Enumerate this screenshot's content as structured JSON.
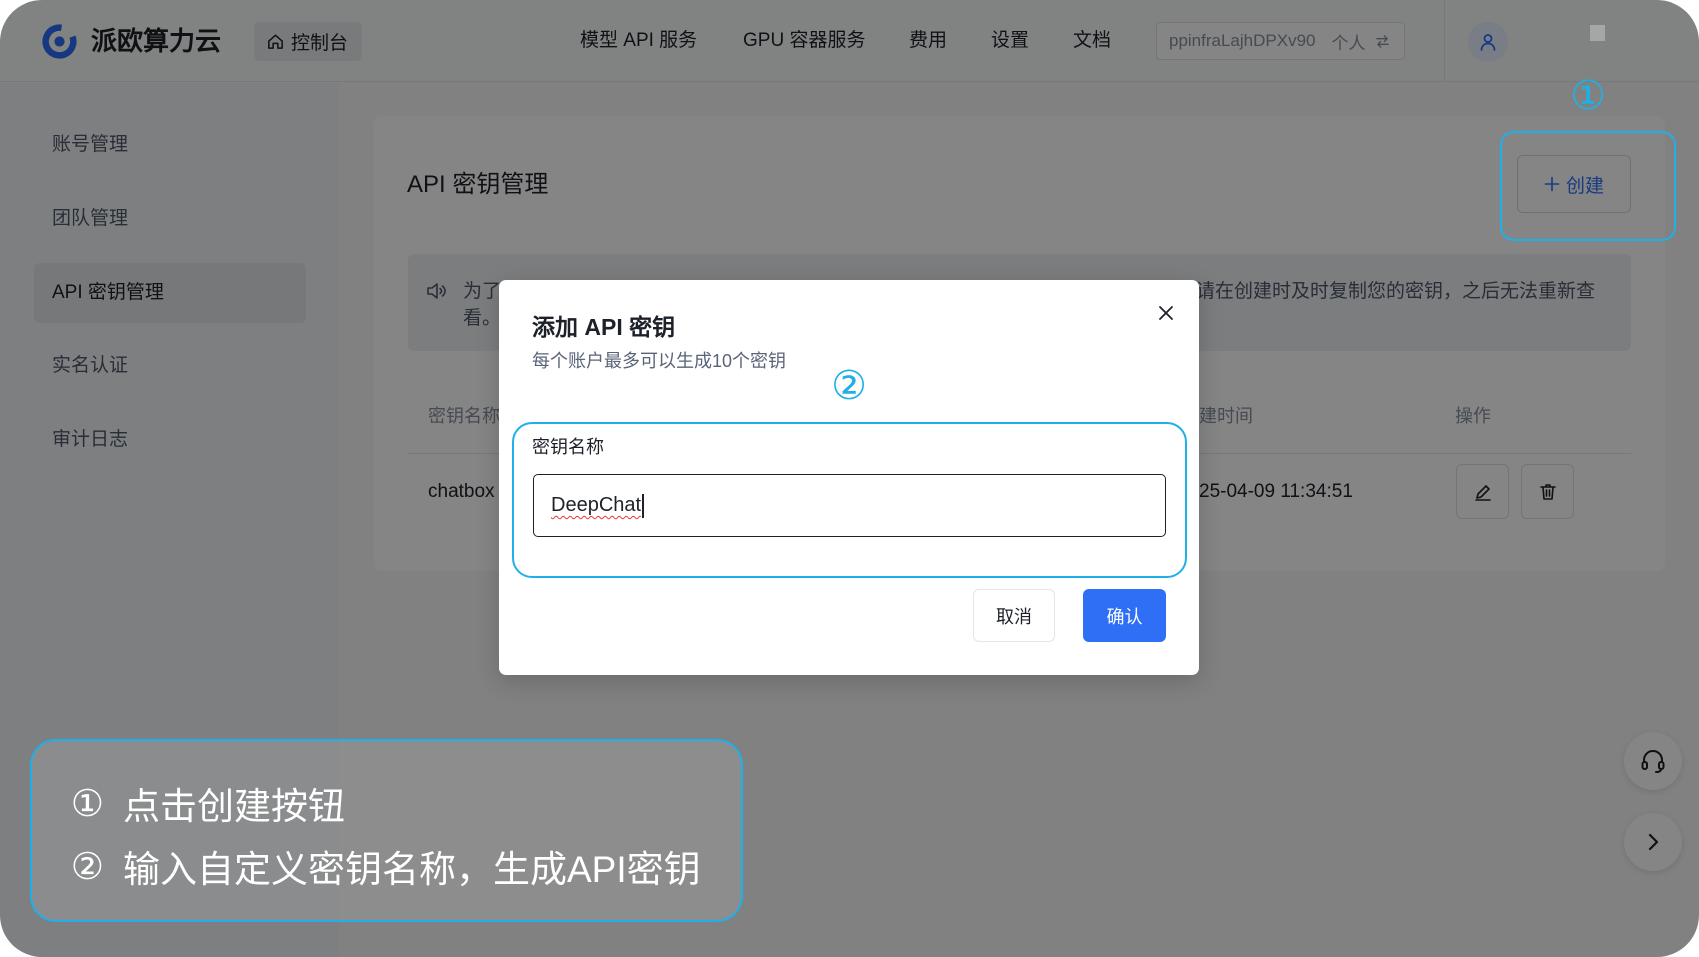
{
  "header": {
    "brand": "派欧算力云",
    "console_label": "控制台",
    "console_icon": "home-icon",
    "nav": [
      {
        "label": "模型 API 服务"
      },
      {
        "label": "GPU 容器服务"
      },
      {
        "label": "费用"
      },
      {
        "label": "设置"
      },
      {
        "label": "文档"
      }
    ],
    "account": {
      "name": "ppinfraLajhDPXv90",
      "type": "个人",
      "icon": "swap-icon"
    },
    "avatar_icon": "user-icon"
  },
  "sidebar": {
    "items": [
      {
        "label": "账号管理"
      },
      {
        "label": "团队管理"
      },
      {
        "label": "API 密钥管理",
        "active": true
      },
      {
        "label": "实名认证"
      },
      {
        "label": "审计日志"
      }
    ]
  },
  "main": {
    "title": "API 密钥管理",
    "create_label": "创建",
    "create_icon": "plus-icon",
    "notice": {
      "icon": "speaker-icon",
      "line1_left": "为了",
      "line1_right": "请在创建时及时复制您的密钥，之后无法重新查",
      "line2": "看。"
    },
    "table": {
      "columns": [
        "密钥名称",
        "建时间",
        "操作"
      ],
      "rows": [
        {
          "name": "chatbox",
          "created": "25-04-09 11:34:51"
        }
      ]
    }
  },
  "modal": {
    "title": "添加 API 密钥",
    "subtitle": "每个账户最多可以生成10个密钥",
    "field_label": "密钥名称",
    "field_value": "DeepChat",
    "cancel_label": "取消",
    "confirm_label": "确认"
  },
  "annotations": {
    "marker_1": "①",
    "marker_2": "②",
    "steps": [
      {
        "marker": "①",
        "text": "点击创建按钮"
      },
      {
        "marker": "②",
        "text": "输入自定义密钥名称，生成API密钥"
      }
    ]
  },
  "colors": {
    "accent": "#2f6ff5",
    "annotation": "#1fb0e8"
  }
}
